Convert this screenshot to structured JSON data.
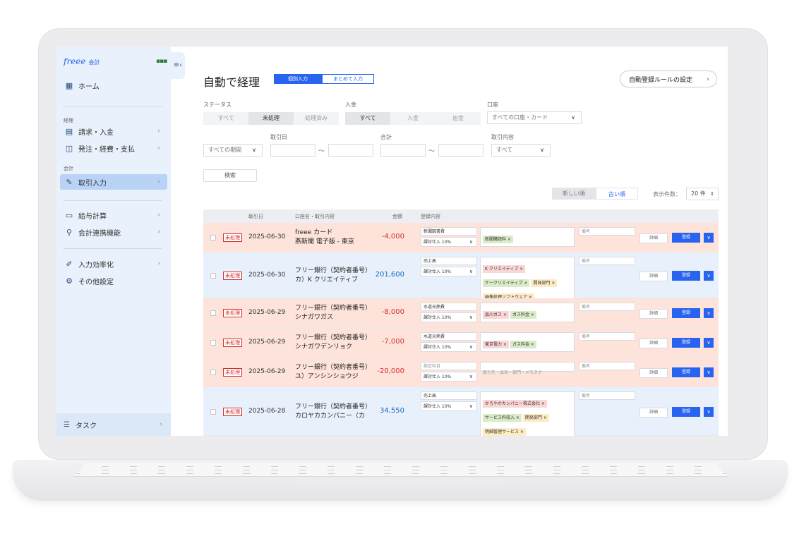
{
  "app": {
    "logo_text": "freee",
    "logo_sub": "会計",
    "collapse_icon": "≡‹"
  },
  "sidebar": {
    "home": "ホーム",
    "sec_keiri": "経理",
    "seikyu": "請求・入金",
    "hatchu": "発注・経費・支払",
    "sec_kaikei": "会計",
    "torihiki": "取引入力",
    "kyuyo": "給与計算",
    "renkei": "会計連携機能",
    "kouritsu": "入力効率化",
    "sonota": "その他設定",
    "task": "タスク"
  },
  "header": {
    "title": "自動で経理",
    "seg_individual": "個別入力",
    "seg_batch": "まとめて入力",
    "rule_button": "自動登録ルールの設定"
  },
  "filters": {
    "status_label": "ステータス",
    "status_options": [
      "すべて",
      "未処理",
      "処理済み"
    ],
    "inout_label": "入金",
    "inout_options": [
      "すべて",
      "入金",
      "出金"
    ],
    "account_label": "口座",
    "account_value": "すべての口座・カード",
    "date_label": "取引日",
    "period_value": "すべての期間",
    "total_label": "合計",
    "content_label": "取引内容",
    "content_value": "すべて",
    "tilde": "〜",
    "search_button": "検索"
  },
  "sort": {
    "newest": "新しい順",
    "oldest": "古い順",
    "perpage_label": "表示件数：",
    "perpage_value": "20 件"
  },
  "table": {
    "headers": {
      "date": "取引日",
      "account": "口座名・取引内容",
      "amount": "金額",
      "register": "登録内容"
    },
    "detail_label": "詳細",
    "register_label": "登録",
    "rows": [
      {
        "badge": "未処理",
        "date": "2025-06-30",
        "acct1": "freee カード",
        "acct2": "燕新聞 電子版 - 東京",
        "amount": "-4,000",
        "item": "新聞図書費",
        "tax": "課対仕入 10%",
        "tags": [
          {
            "t": "新聞購読料 ×",
            "c": "gr"
          }
        ],
        "memo": "備考"
      },
      {
        "badge": "未処理",
        "date": "2025-06-30",
        "acct1": "フリー銀行（契約者番号）",
        "acct2": "カ）K クリエイティブ",
        "amount": "201,600",
        "item": "売上高",
        "tax": "課対仕入 10%",
        "tags": [
          {
            "t": "K クリエイティブ ×",
            "c": "pk"
          },
          {
            "t": "ケークリエイティブ ×",
            "c": "gr"
          },
          {
            "t": "開発部門 ×",
            "c": "yl"
          },
          {
            "t": "画像処理ソフトウェア ×",
            "c": "yl"
          }
        ],
        "memo": "備考"
      },
      {
        "badge": "未処理",
        "date": "2025-06-29",
        "acct1": "フリー銀行（契約者番号）",
        "acct2": "シナガワガス",
        "amount": "-8,000",
        "item": "水道光熱費",
        "tax": "課対仕入 10%",
        "tags": [
          {
            "t": "品川ガス ×",
            "c": "pk"
          },
          {
            "t": "ガス料金 ×",
            "c": "gr"
          }
        ],
        "memo": "備考"
      },
      {
        "badge": "未処理",
        "date": "2025-06-29",
        "acct1": "フリー銀行（契約者番号）",
        "acct2": "シナガワデンリョク",
        "amount": "-7,000",
        "item": "水道光熱費",
        "tax": "課対仕入 10%",
        "tags": [
          {
            "t": "東京電力 ×",
            "c": "pk"
          },
          {
            "t": "ガス料金 ×",
            "c": "gr"
          }
        ],
        "memo": "備考"
      },
      {
        "badge": "未処理",
        "date": "2025-06-29",
        "acct1": "フリー銀行（契約者番号）",
        "acct2": "ユ）アンシンショウジ",
        "amount": "-20,000",
        "item": "勘定科目",
        "tax": "課対仕入 10%",
        "tags_placeholder": "取引先・品目・部門・メモタグ",
        "tags": [],
        "memo": "備考"
      },
      {
        "badge": "未処理",
        "date": "2025-06-28",
        "acct1": "フリー銀行（契約者番号）",
        "acct2": "カロヤカカンパニー（カ",
        "amount": "34,550",
        "item": "売上高",
        "tax": "課対仕入 10%",
        "tags": [
          {
            "t": "かろやかカンパニー株式会社 ×",
            "c": "pk"
          },
          {
            "t": "サービス料収入 ×",
            "c": "gr"
          },
          {
            "t": "開発部門 ×",
            "c": "yl"
          },
          {
            "t": "明細管理サービス ×",
            "c": "yl"
          }
        ],
        "memo": "備考"
      }
    ]
  },
  "colors": {
    "accent": "#2864f0",
    "negative": "#d32f2f",
    "positive": "#1565c0"
  }
}
